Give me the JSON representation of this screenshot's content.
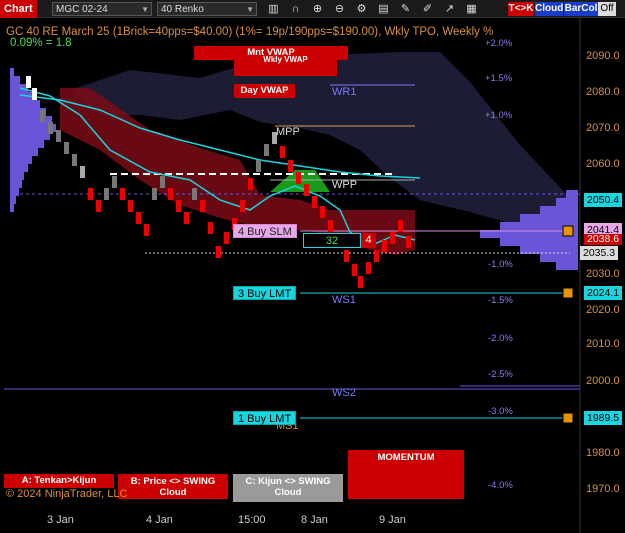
{
  "toolbar": {
    "title": "Chart",
    "instrument": "MGC 02-24",
    "bar_type": "40 Renko",
    "tk_label": "T<>K",
    "cloud_label": "Cloud",
    "barcol_label": "BarCol",
    "off_label": "Off",
    "icons": [
      "bar-chart-icon",
      "magnet-icon",
      "zoom-in-icon",
      "zoom-out-icon",
      "settings-icon",
      "properties-icon",
      "pencil-icon",
      "draw-tool-icon",
      "line-chart-icon",
      "layout-icon"
    ]
  },
  "header": {
    "line1": "GC 40 RE March 25 (1Brick=40pps=$40.00)  (1%= 19p/190pps=$190.00), Wkly TPO, Weekly %",
    "line2": "0.09% = 1.8"
  },
  "labels": {
    "mnt_vwap": "Mnt VWAP",
    "wkly_vwap": "Wkly VWAP",
    "day_vwap": "Day VWAP",
    "mpp": "MPP",
    "wpp": "WPP",
    "wr1": "WR1",
    "ws1": "WS1",
    "ws2": "WS2",
    "ms1": "MS1",
    "box_green_val": "32",
    "box_red_val": "4"
  },
  "orders": {
    "buy_slm": "4 Buy SLM",
    "buy_lmt3": "3 Buy LMT",
    "buy_lmt1": "1 Buy LMT"
  },
  "price_axis": [
    "2090.0",
    "2080.0",
    "2070.0",
    "2060.0",
    "2030.0",
    "2020.0",
    "2010.0",
    "2000.0",
    "1980.0",
    "1970.0"
  ],
  "pct_axis": [
    "+2.0%",
    "+1.5%",
    "+1.0%",
    "-1.0%",
    "-1.5%",
    "-2.0%",
    "-2.5%",
    "-3.0%",
    "-4.0%"
  ],
  "price_tags": {
    "p1": "2050.4",
    "p2": "2041.4",
    "p3": "2038.6",
    "p4": "2035.3",
    "p5": "2024.1",
    "p6": "1989.5"
  },
  "x_axis": [
    "3 Jan",
    "4 Jan",
    "15:00",
    "8 Jan",
    "9 Jan"
  ],
  "buttons": {
    "a": "A: Tenkan>Kijun",
    "b": "B: Price <> SWING Cloud",
    "c": "C: Kijun <> SWING Cloud",
    "momentum": "MOMENTUM"
  },
  "copyright": "© 2024 NinjaTrader, LLC",
  "colors": {
    "accent_red": "#cc0000",
    "cyan": "#19d5e0",
    "price_orange": "#d89040",
    "pct_purple": "#8a7cf0",
    "green_box": "#1a9a1a"
  }
}
